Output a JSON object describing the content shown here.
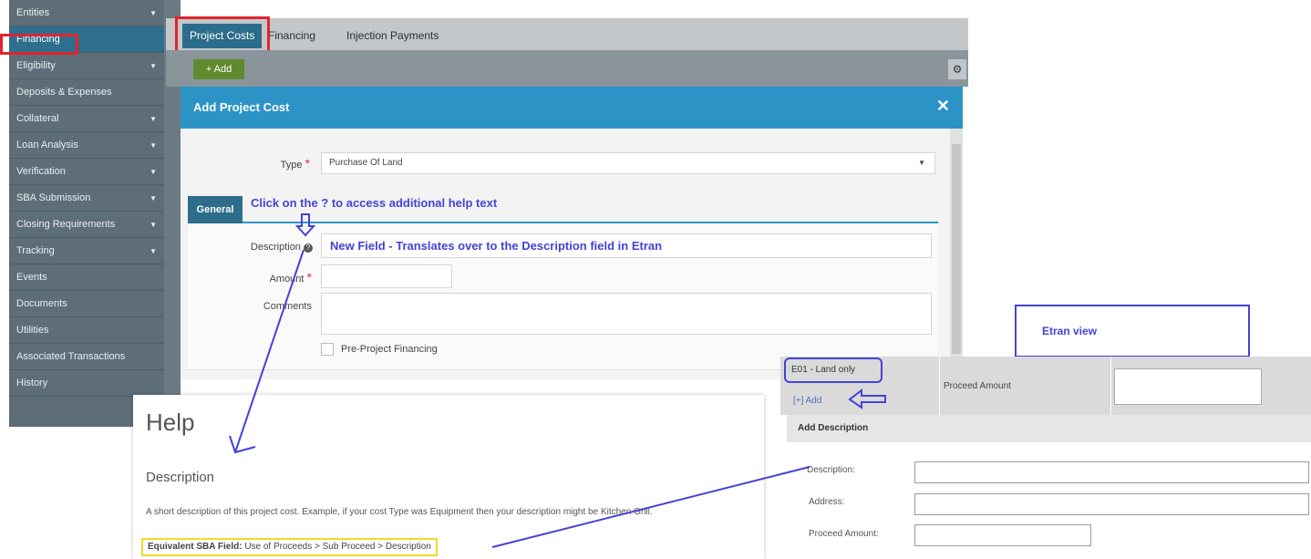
{
  "sidebar": {
    "items": [
      {
        "label": "Entities",
        "chevron": true
      },
      {
        "label": "Financing",
        "chevron": false,
        "active": true
      },
      {
        "label": "Eligibility",
        "chevron": true
      },
      {
        "label": "Deposits & Expenses",
        "chevron": false
      },
      {
        "label": "Collateral",
        "chevron": true
      },
      {
        "label": "Loan Analysis",
        "chevron": true
      },
      {
        "label": "Verification",
        "chevron": true
      },
      {
        "label": "SBA Submission",
        "chevron": true
      },
      {
        "label": "Closing Requirements",
        "chevron": true
      },
      {
        "label": "Tracking",
        "chevron": true
      },
      {
        "label": "Events",
        "chevron": false
      },
      {
        "label": "Documents",
        "chevron": false
      },
      {
        "label": "Utilities",
        "chevron": false
      },
      {
        "label": "Associated Transactions",
        "chevron": false
      },
      {
        "label": "History",
        "chevron": false
      }
    ]
  },
  "tabs": {
    "project_costs": "Project Costs",
    "financing": "Financing",
    "injection_payments": "Injection Payments"
  },
  "toolbar": {
    "add_label": "+ Add",
    "gear_glyph": "⚙"
  },
  "modal": {
    "title": "Add Project Cost",
    "close_glyph": "✕",
    "type_label": "Type",
    "type_value": "Purchase Of Land",
    "req_mark": "*",
    "general_tab": "General",
    "description_label": "Description",
    "help_glyph": "?",
    "amount_label": "Amount",
    "comments_label": "Comments",
    "preproject_label": "Pre-Project Financing"
  },
  "annotations": {
    "click_help": "Click on the ? to access additional help text",
    "new_field": "New Field - Translates over to the Description field in Etran",
    "etran_view": "Etran view"
  },
  "help": {
    "title": "Help",
    "subtitle": "Description",
    "body_text": "A short description of this project cost. Example, if your cost Type was Equipment then your description might be Kitchen Grill.",
    "equivalent_label": "Equivalent SBA Field:",
    "equivalent_value": "Use of Proceeds > Sub Proceed > Description"
  },
  "etran": {
    "code": "E01 - Land only",
    "add_link": "[+] Add",
    "proceed_amount_label": "Proceed Amount",
    "add_description": "Add Description",
    "description_label": "Description:",
    "address_label": "Address:",
    "proceed_amount_field_label": "Proceed Amount:"
  },
  "colors": {
    "sidebar_bg": "#5e6e78",
    "active_tab": "#2c6c8c",
    "modal_header": "#2c93c6",
    "annotation_blue": "#4343d6",
    "highlight_red": "#e0252d",
    "highlight_yellow": "#e7de2e"
  },
  "icons": {
    "close": "close-icon",
    "gear": "gear-icon",
    "help": "help-icon",
    "chevron": "chevron-down-icon",
    "dropdown": "caret-down-icon"
  }
}
